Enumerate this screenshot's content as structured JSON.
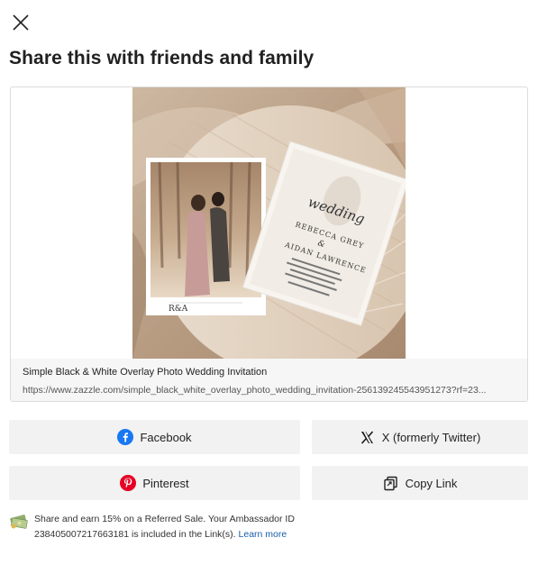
{
  "dialog": {
    "title": "Share this with friends and family"
  },
  "preview": {
    "product_title": "Simple Black & White Overlay Photo Wedding Invitation",
    "url": "https://www.zazzle.com/simple_black_white_overlay_photo_wedding_invitation-256139245543951273?rf=23...",
    "image_alt": "Wedding invitation with couple photo on wooden board",
    "invitation_text": {
      "line1": "wedding",
      "name1": "REBECCA GREY",
      "amp": "&",
      "name2": "AIDAN LAWRENCE",
      "monogram": "R&A"
    }
  },
  "share_buttons": {
    "facebook": "Facebook",
    "x": "X (formerly Twitter)",
    "pinterest": "Pinterest",
    "copy": "Copy Link"
  },
  "footer": {
    "text": "Share and earn 15% on a Referred Sale. Your Ambassador ID 238405007217663181 is included in the Link(s).",
    "link": "Learn more"
  },
  "colors": {
    "facebook": "#1877f2",
    "pinterest": "#e60023",
    "link": "#1a5fa8",
    "button_bg": "#f2f2f2"
  }
}
